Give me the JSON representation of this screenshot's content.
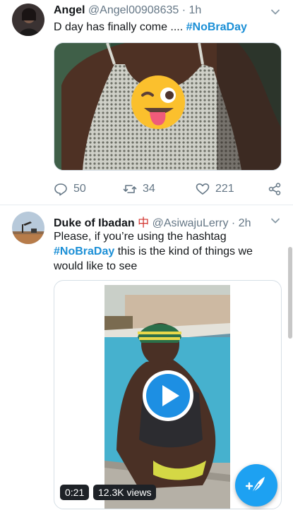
{
  "tweets": [
    {
      "name": "Angel",
      "handle": "@Angel00908635",
      "sep": "·",
      "time": "1h",
      "text_before": "D day has finally come .... ",
      "hashtag": "#NoBraDay",
      "replies": "50",
      "retweets": "34",
      "likes": "221",
      "media_overlay_icon": "winking-face-tongue-emoji"
    },
    {
      "name": "Duke of Ibadan",
      "name_emoji": "中",
      "handle": "@AsiwajuLerry",
      "sep": "·",
      "time": "2h",
      "text_line1": "Please, if you’re using the hashtag",
      "hashtag": "#NoBraDay",
      "text_line2_rest": " this is the kind of things we",
      "text_line3": "would like to see",
      "video_duration": "0:21",
      "video_views": "12.3K views"
    }
  ],
  "colors": {
    "accent": "#1da1f2",
    "hashtag": "#1b8fd6",
    "muted": "#657786"
  }
}
